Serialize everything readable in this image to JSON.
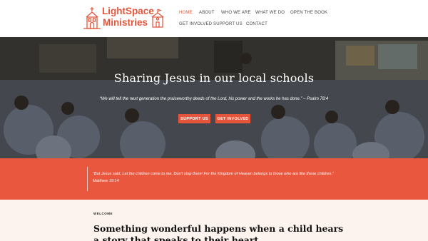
{
  "header": {
    "logo": {
      "line1": "LightSpace",
      "line2": "Ministries"
    },
    "nav": [
      {
        "label": "HOME",
        "active": true
      },
      {
        "label": "ABOUT",
        "active": false
      },
      {
        "label": "WHO WE ARE",
        "active": false
      },
      {
        "label": "WHAT WE DO",
        "active": false
      },
      {
        "label": "OPEN THE BOOK",
        "active": false
      },
      {
        "label": "GET INVOLVED",
        "active": false
      },
      {
        "label": "SUPPORT US",
        "active": false
      },
      {
        "label": "CONTACT",
        "active": false
      }
    ]
  },
  "hero": {
    "title": "Sharing Jesus in our local schools",
    "quote": "“We will tell the next generation the praiseworthy deeds of the Lord, his power and the works he has done.” – Psalm 78:4",
    "buttons": {
      "support": "SUPPORT US",
      "involved": "GET INVOLVED"
    }
  },
  "band": {
    "quote": "“But Jesus said, Let the children come to me. Don't stop them! For the Kingdom of Heaven belongs to those who are like these children.” Matthew 19:14"
  },
  "welcome": {
    "label": "WELCOME",
    "heading": "Something wonderful happens when a child hears a story that speaks to their heart"
  },
  "colors": {
    "accent": "#e4553b",
    "band": "#e8573e",
    "cream": "#fdf3ee"
  }
}
